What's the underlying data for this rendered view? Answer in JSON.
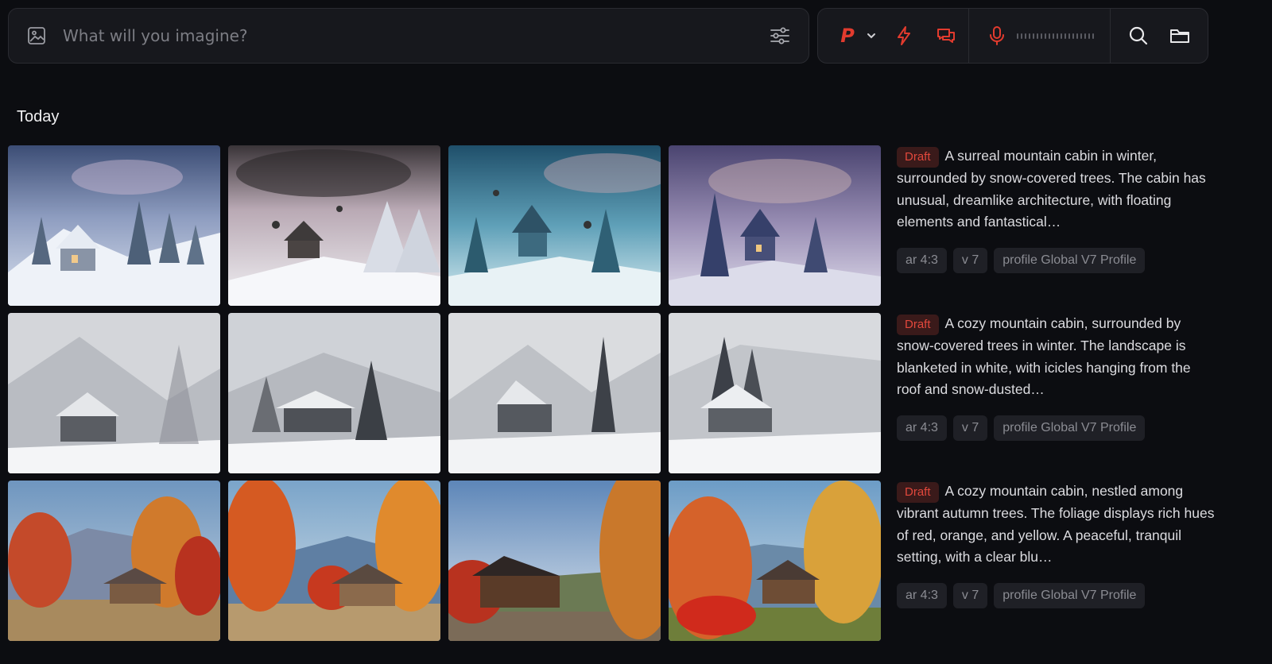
{
  "prompt": {
    "placeholder": "What will you imagine?",
    "value": ""
  },
  "toolbar": {
    "personalize_label": "P",
    "accent_color": "#e23b2e"
  },
  "section": {
    "title": "Today"
  },
  "rows": [
    {
      "badge": "Draft",
      "description": "A surreal mountain cabin in winter, surrounded by snow-covered trees. The cabin has unusual, dreamlike architecture, with floating elements and fantastical…",
      "tags": [
        "ar 4:3",
        "v 7",
        "profile Global V7 Profile"
      ],
      "images": [
        "surreal-winter-cabin-1",
        "surreal-winter-cabin-2",
        "surreal-winter-cabin-3",
        "surreal-winter-cabin-4"
      ]
    },
    {
      "badge": "Draft",
      "description": "A cozy mountain cabin, surrounded by snow-covered trees in winter. The landscape is blanketed in white, with icicles hanging from the roof and snow-dusted…",
      "tags": [
        "ar 4:3",
        "v 7",
        "profile Global V7 Profile"
      ],
      "images": [
        "snowy-cabin-1",
        "snowy-cabin-2",
        "snowy-cabin-3",
        "snowy-cabin-4"
      ]
    },
    {
      "badge": "Draft",
      "description": "A cozy mountain cabin, nestled among vibrant autumn trees. The foliage displays rich hues of red, orange, and yellow. A peaceful, tranquil setting, with a clear blu…",
      "tags": [
        "ar 4:3",
        "v 7",
        "profile Global V7 Profile"
      ],
      "images": [
        "autumn-cabin-1",
        "autumn-cabin-2",
        "autumn-cabin-3",
        "autumn-cabin-4"
      ]
    }
  ]
}
